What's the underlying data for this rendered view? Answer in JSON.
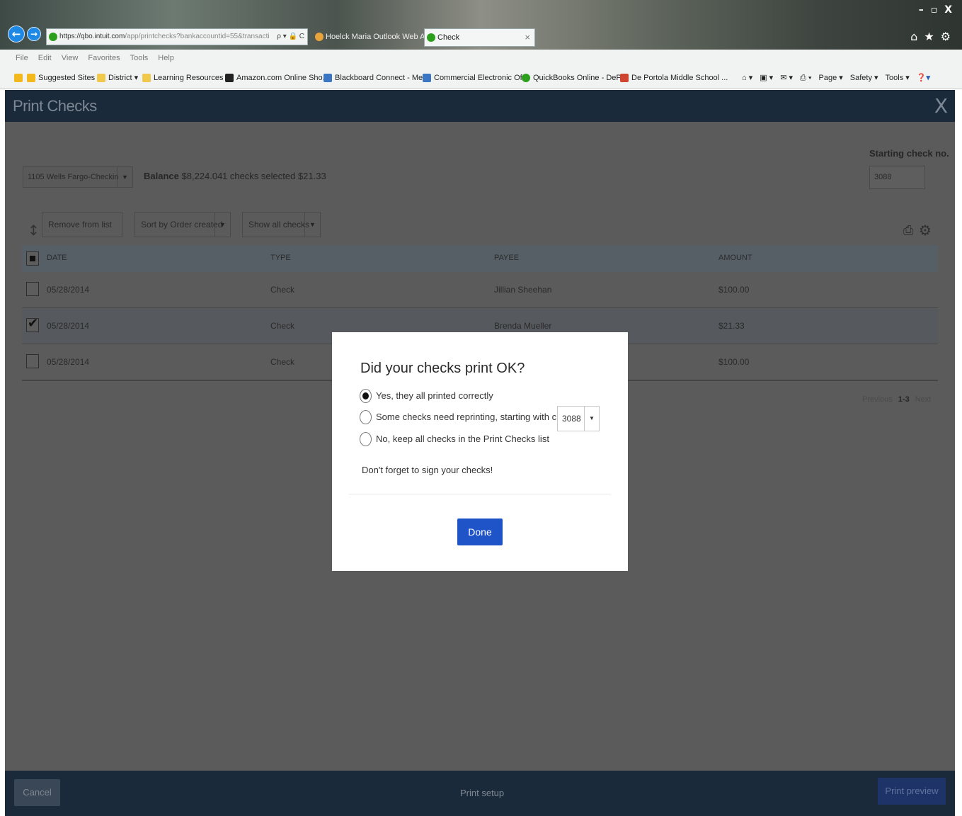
{
  "browser": {
    "url_prefix": "https://",
    "url_host": "qbo.intuit.com",
    "url_path": "/app/printchecks?bankaccountid=55&transacti",
    "url_tail": "ρ ▾ 🔒 C",
    "tabs": [
      {
        "label": "Hoelck Maria  Outlook Web A...",
        "icon_color": "#e8a33d"
      },
      {
        "label": "Check",
        "icon_color": "#2ca01c"
      }
    ],
    "tab_close": "×",
    "window_controls": [
      "–",
      "▫",
      "X"
    ],
    "right_icons": [
      "⌂",
      "★",
      "⚙"
    ],
    "menu": [
      "File",
      "Edit",
      "View",
      "Favorites",
      "Tools",
      "Help"
    ],
    "favorites": [
      {
        "label": "Suggested Sites ▾",
        "icon_color": "#f2b81c"
      },
      {
        "label": "District ▾",
        "icon_color": "#f0c94a"
      },
      {
        "label": "Learning Resources ▾",
        "icon_color": "#f0c94a"
      },
      {
        "label": "Amazon.com Online Sho...",
        "icon_color": "#222222"
      },
      {
        "label": "Blackboard Connect - Me...",
        "icon_color": "#3a76c4"
      },
      {
        "label": "Commercial Electronic Of...",
        "icon_color": "#3a76c4"
      },
      {
        "label": "QuickBooks Online - DeP...",
        "icon_color": "#2ca01c"
      },
      {
        "label": "De Portola Middle School ...",
        "icon_color": "#d0452f"
      }
    ],
    "command_bar": [
      "Page ▾",
      "Safety ▾",
      "Tools ▾"
    ]
  },
  "app": {
    "title": "Print Checks",
    "close": "X",
    "account": "1105 Wells Fargo-Checkin",
    "balance_label": "Balance",
    "balance_value": "$8,224.04",
    "selected_info": "1 checks selected $21.33",
    "starting_check_label": "Starting check no.",
    "starting_check_value": "3088",
    "remove_button": "Remove from list",
    "sort_button": "Sort by Order created",
    "show_button": "Show all checks",
    "columns": [
      "DATE",
      "TYPE",
      "PAYEE",
      "AMOUNT"
    ],
    "rows": [
      {
        "date": "05/28/2014",
        "type": "Check",
        "payee": "Jillian Sheehan",
        "amount": "$100.00",
        "checked": false
      },
      {
        "date": "05/28/2014",
        "type": "Check",
        "payee": "Brenda Mueller",
        "amount": "$21.33",
        "checked": true
      },
      {
        "date": "05/28/2014",
        "type": "Check",
        "payee": "",
        "amount": "$100.00",
        "checked": false
      }
    ],
    "pager": {
      "previous": "Previous",
      "range": "1-3",
      "next": "Next"
    },
    "footer": {
      "cancel": "Cancel",
      "print_setup": "Print setup",
      "print_preview": "Print preview"
    }
  },
  "modal": {
    "title": "Did your checks print OK?",
    "options": [
      {
        "label": "Yes, they all printed correctly",
        "selected": true
      },
      {
        "label": "Some checks need reprinting, starting with check:",
        "selected": false
      },
      {
        "label": "No, keep all checks in the Print Checks list",
        "selected": false
      }
    ],
    "reprint_value": "3088",
    "note": "Don't forget to sign your checks!",
    "done": "Done"
  }
}
